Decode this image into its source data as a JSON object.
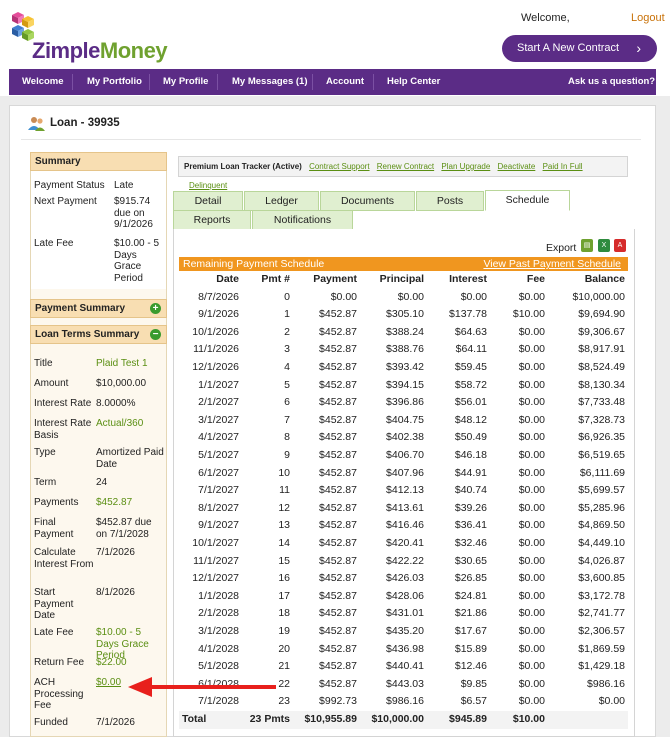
{
  "header": {
    "logo": {
      "zimple": "Zimple",
      "money": "Money"
    },
    "welcome": "Welcome,",
    "logout": "Logout",
    "cta": "Start A New Contract"
  },
  "nav": [
    "Welcome",
    "My Portfolio",
    "My Profile",
    "My Messages (1)",
    "Account",
    "Help Center",
    "Ask us a question?"
  ],
  "loan": {
    "title": "Loan - 39935"
  },
  "summary": {
    "heading": "Summary",
    "rows": [
      {
        "label": "Payment Status",
        "value": "Late"
      },
      {
        "label": "Next Payment",
        "value": "$915.74 due on 9/1/2026"
      },
      {
        "label": "Late Fee",
        "value": "$10.00 - 5 Days Grace Period"
      }
    ]
  },
  "payment_summary": {
    "heading": "Payment Summary"
  },
  "loan_terms": {
    "heading": "Loan Terms Summary",
    "rows": [
      {
        "label": "Title",
        "value": "Plaid Test 1",
        "green": true
      },
      {
        "label": "Amount",
        "value": "$10,000.00"
      },
      {
        "label": "Interest Rate",
        "value": "8.0000%"
      },
      {
        "label": "Interest Rate Basis",
        "value": "Actual/360",
        "green": true
      },
      {
        "label": "Type",
        "value": "Amortized Paid Date"
      },
      {
        "label": "Term",
        "value": "24"
      },
      {
        "label": "Payments",
        "value": "$452.87",
        "green": true
      },
      {
        "label": "Final Payment",
        "value": "$452.87 due on 7/1/2028"
      },
      {
        "label": "Calculate Interest From",
        "value": "7/1/2026"
      },
      {
        "label": "Start Payment Date",
        "value": "8/1/2026"
      },
      {
        "label": "Late Fee",
        "value": "$10.00 - 5 Days Grace Period",
        "green": true
      },
      {
        "label": "Return Fee",
        "value": "$22.00",
        "green": true
      },
      {
        "label": "ACH Processing Fee",
        "value": "$0.00",
        "green": true,
        "link": true
      },
      {
        "label": "Funded",
        "value": "7/1/2026"
      }
    ]
  },
  "tracker": {
    "title": "Premium Loan Tracker (Active)",
    "links": [
      "Contract Support",
      "Renew Contract",
      "Plan Upgrade",
      "Deactivate",
      "Paid In Full",
      "Delinquent"
    ]
  },
  "tabs": [
    "Detail",
    "Ledger",
    "Documents",
    "Posts",
    "Schedule",
    "Reports",
    "Notifications"
  ],
  "active_tab": "Schedule",
  "export_label": "Export",
  "export_icons": [
    "printer-icon",
    "excel-icon",
    "pdf-icon"
  ],
  "schedule": {
    "heading": "Remaining Payment Schedule",
    "past_link": "View Past Payment Schedule",
    "columns": [
      "Date",
      "Pmt #",
      "Payment",
      "Principal",
      "Interest",
      "Fee",
      "Balance"
    ],
    "rows": [
      [
        "8/7/2026",
        "0",
        "$0.00",
        "$0.00",
        "$0.00",
        "$0.00",
        "$10,000.00"
      ],
      [
        "9/1/2026",
        "1",
        "$452.87",
        "$305.10",
        "$137.78",
        "$10.00",
        "$9,694.90"
      ],
      [
        "10/1/2026",
        "2",
        "$452.87",
        "$388.24",
        "$64.63",
        "$0.00",
        "$9,306.67"
      ],
      [
        "11/1/2026",
        "3",
        "$452.87",
        "$388.76",
        "$64.11",
        "$0.00",
        "$8,917.91"
      ],
      [
        "12/1/2026",
        "4",
        "$452.87",
        "$393.42",
        "$59.45",
        "$0.00",
        "$8,524.49"
      ],
      [
        "1/1/2027",
        "5",
        "$452.87",
        "$394.15",
        "$58.72",
        "$0.00",
        "$8,130.34"
      ],
      [
        "2/1/2027",
        "6",
        "$452.87",
        "$396.86",
        "$56.01",
        "$0.00",
        "$7,733.48"
      ],
      [
        "3/1/2027",
        "7",
        "$452.87",
        "$404.75",
        "$48.12",
        "$0.00",
        "$7,328.73"
      ],
      [
        "4/1/2027",
        "8",
        "$452.87",
        "$402.38",
        "$50.49",
        "$0.00",
        "$6,926.35"
      ],
      [
        "5/1/2027",
        "9",
        "$452.87",
        "$406.70",
        "$46.18",
        "$0.00",
        "$6,519.65"
      ],
      [
        "6/1/2027",
        "10",
        "$452.87",
        "$407.96",
        "$44.91",
        "$0.00",
        "$6,111.69"
      ],
      [
        "7/1/2027",
        "11",
        "$452.87",
        "$412.13",
        "$40.74",
        "$0.00",
        "$5,699.57"
      ],
      [
        "8/1/2027",
        "12",
        "$452.87",
        "$413.61",
        "$39.26",
        "$0.00",
        "$5,285.96"
      ],
      [
        "9/1/2027",
        "13",
        "$452.87",
        "$416.46",
        "$36.41",
        "$0.00",
        "$4,869.50"
      ],
      [
        "10/1/2027",
        "14",
        "$452.87",
        "$420.41",
        "$32.46",
        "$0.00",
        "$4,449.10"
      ],
      [
        "11/1/2027",
        "15",
        "$452.87",
        "$422.22",
        "$30.65",
        "$0.00",
        "$4,026.87"
      ],
      [
        "12/1/2027",
        "16",
        "$452.87",
        "$426.03",
        "$26.85",
        "$0.00",
        "$3,600.85"
      ],
      [
        "1/1/2028",
        "17",
        "$452.87",
        "$428.06",
        "$24.81",
        "$0.00",
        "$3,172.78"
      ],
      [
        "2/1/2028",
        "18",
        "$452.87",
        "$431.01",
        "$21.86",
        "$0.00",
        "$2,741.77"
      ],
      [
        "3/1/2028",
        "19",
        "$452.87",
        "$435.20",
        "$17.67",
        "$0.00",
        "$2,306.57"
      ],
      [
        "4/1/2028",
        "20",
        "$452.87",
        "$436.98",
        "$15.89",
        "$0.00",
        "$1,869.59"
      ],
      [
        "5/1/2028",
        "21",
        "$452.87",
        "$440.41",
        "$12.46",
        "$0.00",
        "$1,429.18"
      ],
      [
        "6/1/2028",
        "22",
        "$452.87",
        "$443.03",
        "$9.85",
        "$0.00",
        "$986.16"
      ],
      [
        "7/1/2028",
        "23",
        "$992.73",
        "$986.16",
        "$6.57",
        "$0.00",
        "$0.00"
      ]
    ],
    "total": [
      "Total",
      "23 Pmts",
      "$10,955.89",
      "$10,000.00",
      "$945.89",
      "$10.00",
      ""
    ]
  },
  "colors": {
    "brand_purple": "#5b2c86",
    "accent_green": "#6fa12f",
    "orange": "#f0961f",
    "arrow_red": "#e8201c"
  }
}
